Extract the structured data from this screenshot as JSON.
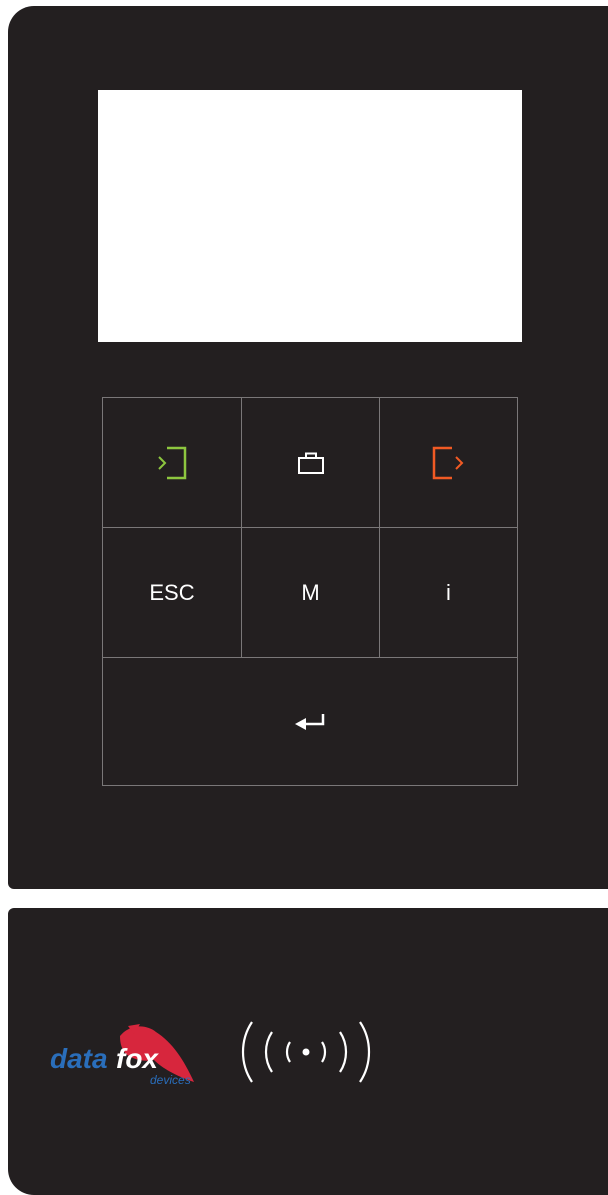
{
  "device": {
    "keys": {
      "come": {
        "icon": "login-arrow-icon",
        "color": "#8dc63f"
      },
      "business": {
        "icon": "briefcase-icon",
        "color": "#ffffff"
      },
      "go": {
        "icon": "logout-arrow-icon",
        "color": "#f15a24"
      },
      "esc_label": "ESC",
      "menu_label": "M",
      "info_label": "i",
      "enter": {
        "icon": "enter-arrow-icon",
        "color": "#ffffff"
      }
    },
    "logo": {
      "brand_part1": "data",
      "brand_part2": "fox",
      "sub": "devices",
      "colors": {
        "blue": "#2a6ebb",
        "red": "#d7263d"
      }
    },
    "nfc": {
      "icon": "contactless-reader-icon",
      "glyph": "((•))"
    }
  }
}
